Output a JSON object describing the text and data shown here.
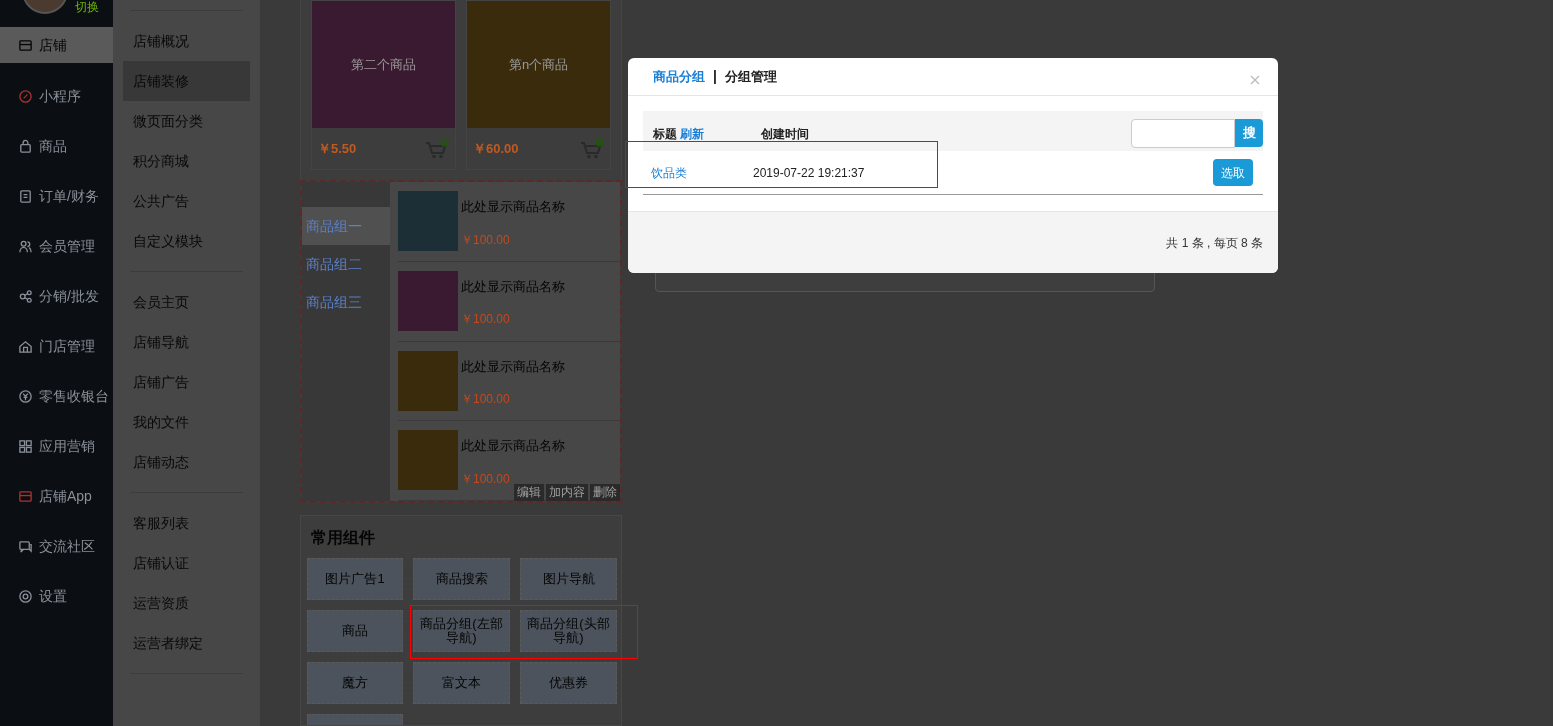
{
  "nav": {
    "switch_label": "切换",
    "items": [
      {
        "label": "店铺",
        "selected": true
      },
      {
        "label": "小程序",
        "selected": false
      },
      {
        "label": "商品",
        "selected": false
      },
      {
        "label": "订单/财务",
        "selected": false
      },
      {
        "label": "会员管理",
        "selected": false
      },
      {
        "label": "分销/批发",
        "selected": false
      },
      {
        "label": "门店管理",
        "selected": false
      },
      {
        "label": "零售收银台",
        "selected": false
      },
      {
        "label": "应用营销",
        "selected": false
      },
      {
        "label": "店铺App",
        "selected": false
      },
      {
        "label": "交流社区",
        "selected": false
      },
      {
        "label": "设置",
        "selected": false
      }
    ]
  },
  "subnav": {
    "groups": [
      [
        {
          "label": "店铺概况",
          "selected": false
        },
        {
          "label": "店铺装修",
          "selected": true
        },
        {
          "label": "微页面分类",
          "selected": false
        },
        {
          "label": "积分商城",
          "selected": false
        },
        {
          "label": "公共广告",
          "selected": false
        },
        {
          "label": "自定义模块",
          "selected": false
        }
      ],
      [
        {
          "label": "会员主页",
          "selected": false
        },
        {
          "label": "店铺导航",
          "selected": false
        },
        {
          "label": "店铺广告",
          "selected": false
        },
        {
          "label": "我的文件",
          "selected": false
        },
        {
          "label": "店铺动态",
          "selected": false
        }
      ],
      [
        {
          "label": "客服列表",
          "selected": false
        },
        {
          "label": "店铺认证",
          "selected": false
        },
        {
          "label": "运营资质",
          "selected": false
        },
        {
          "label": "运营者绑定",
          "selected": false
        }
      ]
    ]
  },
  "preview": {
    "products": [
      {
        "title": "第二个商品",
        "price": "￥5.50",
        "color": "#3a1a30"
      },
      {
        "title": "第n个商品",
        "price": "￥60.00",
        "color": "#3a2b0c"
      }
    ],
    "group_tabs": [
      {
        "label": "商品组一",
        "selected": true
      },
      {
        "label": "商品组二",
        "selected": false
      },
      {
        "label": "商品组三",
        "selected": false
      }
    ],
    "group_items": [
      {
        "name": "此处显示商品名称",
        "price": "￥100.00",
        "color": "#1c2e36"
      },
      {
        "name": "此处显示商品名称",
        "price": "￥100.00",
        "color": "#3a1a30"
      },
      {
        "name": "此处显示商品名称",
        "price": "￥100.00",
        "color": "#3a2b0c"
      },
      {
        "name": "此处显示商品名称",
        "price": "￥100.00",
        "color": "#3a2b0c"
      }
    ],
    "actions": [
      "编辑",
      "加内容",
      "删除"
    ]
  },
  "components": {
    "title": "常用组件",
    "items": [
      "图片广告1",
      "商品搜索",
      "图片导航",
      "商品",
      "商品分组(左部导航)",
      "商品分组(头部导航)",
      "魔方",
      "富文本",
      "优惠券"
    ]
  },
  "modal": {
    "tabs": [
      {
        "label": "商品分组",
        "selected": true
      },
      {
        "label": "分组管理",
        "selected": false
      }
    ],
    "separator": "|",
    "columns": [
      "标题",
      "创建时间"
    ],
    "refresh_link": "刷新",
    "search_button": "搜",
    "rows": [
      {
        "title": "饮品类",
        "created": "2019-07-22 19:21:37",
        "action": "选取"
      }
    ],
    "footer": "共 1 条 , 每页 8 条"
  }
}
